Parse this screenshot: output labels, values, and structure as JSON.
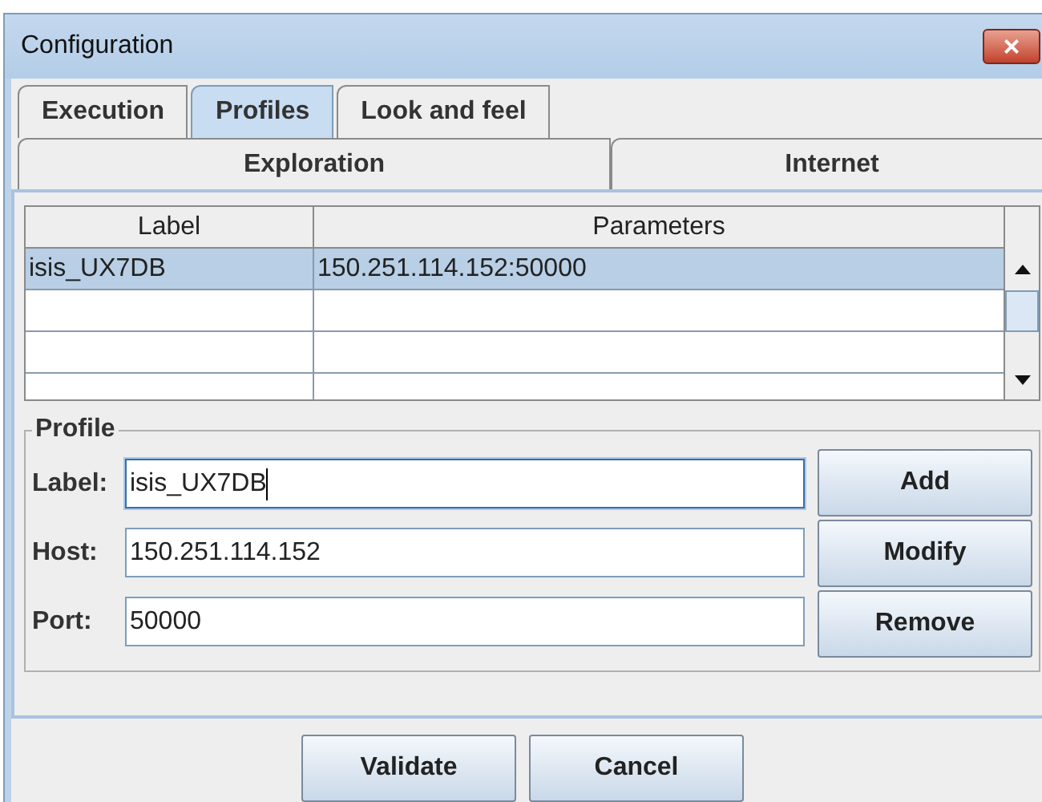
{
  "window": {
    "title": "Configuration",
    "close": "×"
  },
  "tabs": [
    {
      "label": "Execution",
      "selected": false
    },
    {
      "label": "Profiles",
      "selected": true
    },
    {
      "label": "Look and feel",
      "selected": false
    }
  ],
  "subtabs": [
    {
      "label": "Exploration",
      "selected": false
    },
    {
      "label": "Internet",
      "selected": false
    }
  ],
  "table": {
    "columns": [
      "Label",
      "Parameters"
    ],
    "rows": [
      {
        "cells": [
          "isis_UX7DB",
          "150.251.114.152:50000"
        ],
        "selected": true
      }
    ]
  },
  "profile": {
    "title": "Profile",
    "fields": [
      {
        "label": "Label:",
        "value": "isis_UX7DB",
        "focused": true
      },
      {
        "label": "Host:",
        "value": "150.251.114.152",
        "focused": false
      },
      {
        "label": "Port:",
        "value": "50000",
        "focused": false
      }
    ],
    "buttons": [
      "Add",
      "Modify",
      "Remove"
    ]
  },
  "buttons": [
    "Validate",
    "Cancel"
  ]
}
